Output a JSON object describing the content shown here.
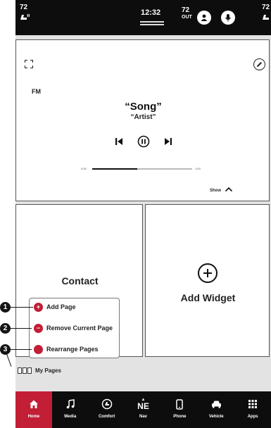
{
  "status_bar": {
    "driver_temp": "72",
    "passenger_temp": "72",
    "clock": "12:32",
    "outside_temp": "72",
    "outside_label": "OUT",
    "left_icon": "heated-seat-icon",
    "right_icon": "heated-seat-icon",
    "buttons": [
      "driver-profile-icon",
      "microphone-icon"
    ]
  },
  "media_widget": {
    "band": "FM",
    "song": "“Song”",
    "artist": "“Artist”",
    "progress_start": "0:00",
    "progress_end": "1:00",
    "progress_fraction": 0.45,
    "show_label": "Show",
    "icons": [
      "expand-icon",
      "edit-icon",
      "previous-track-icon",
      "pause-icon",
      "next-track-icon",
      "chevron-up-icon"
    ]
  },
  "contact_widget": {
    "label": "Contact"
  },
  "add_widget": {
    "label": "Add Widget",
    "icon": "plus-circle-icon"
  },
  "page_menu": {
    "items": [
      {
        "label": "Add Page",
        "glyph": "+",
        "callout": "1"
      },
      {
        "label": "Remove Current Page",
        "glyph": "−",
        "callout": "2"
      },
      {
        "label": "Rearrange Pages",
        "glyph": "",
        "callout": "3"
      }
    ]
  },
  "my_pages": {
    "label": "My Pages"
  },
  "bottom_nav": {
    "items": [
      {
        "label": "Home",
        "icon": "home-icon",
        "active": true
      },
      {
        "label": "Media",
        "icon": "music-note-icon",
        "active": false
      },
      {
        "label": "Comfort",
        "icon": "comfort-icon",
        "active": false
      },
      {
        "label": "Nav",
        "icon": "compass-icon",
        "heading": "NE",
        "active": false
      },
      {
        "label": "Phone",
        "icon": "phone-icon",
        "active": false
      },
      {
        "label": "Vehicle",
        "icon": "car-icon",
        "active": false
      },
      {
        "label": "Apps",
        "icon": "apps-grid-icon",
        "active": false
      }
    ]
  },
  "colors": {
    "accent": "#c21e35",
    "bar_background": "#0d0d0d",
    "panel_background": "#e3e3e3"
  }
}
